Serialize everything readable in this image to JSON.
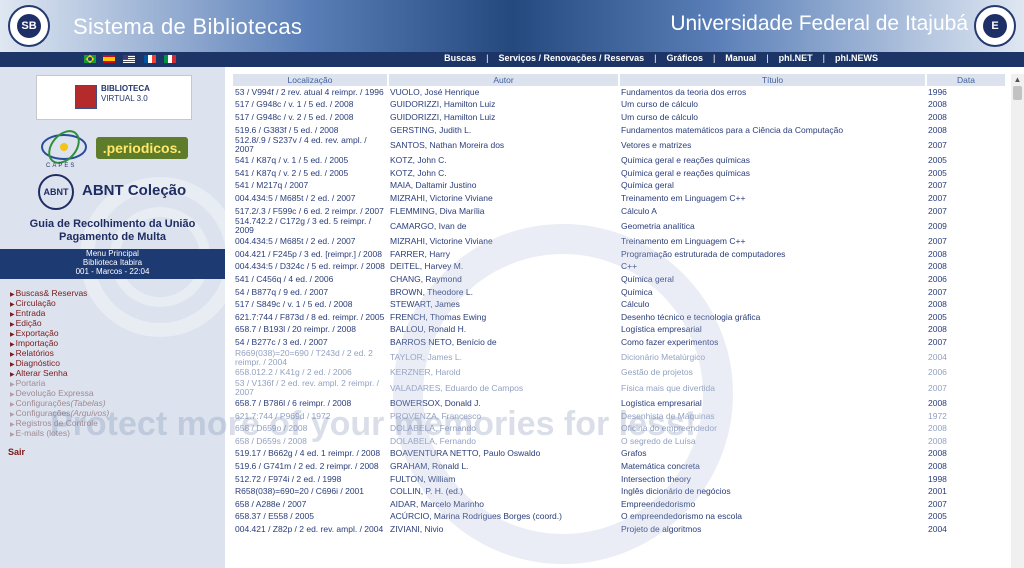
{
  "header": {
    "site_title": "Sistema de Bibliotecas",
    "university": "Universidade Federal de Itajubá",
    "left_logo_text": "SB",
    "right_logo_text": "E"
  },
  "nav": {
    "links": [
      "Buscas",
      "Serviços / Renovações / Reservas",
      "Gráficos",
      "Manual",
      "phl.NET",
      "phl.NEWS"
    ],
    "flags": [
      "flag-brazil",
      "flag-spain",
      "flag-usa",
      "flag-france",
      "flag-italy"
    ]
  },
  "sidebar": {
    "bv_line1": "BIBLIOTECA",
    "bv_line2": "VIRTUAL 3.0",
    "capes": "CAPES",
    "periodicos": ".periodicos.",
    "abnt_circle": "ABNT",
    "abnt_text": "ABNT Coleção",
    "guia_line1": "Guia de Recolhimento da União",
    "guia_line2": "Pagamento de Multa",
    "menu_box": [
      "Menu Principal",
      "Biblioteca Itabira",
      "001 - Marcos - 22:04"
    ],
    "menu": [
      {
        "label": "Buscas& Reservas",
        "extra": ""
      },
      {
        "label": "Circulação",
        "extra": ""
      },
      {
        "label": "Entrada",
        "extra": ""
      },
      {
        "label": "Edição",
        "extra": ""
      },
      {
        "label": "Exportação",
        "extra": ""
      },
      {
        "label": "Importação",
        "extra": ""
      },
      {
        "label": "Relatórios",
        "extra": ""
      },
      {
        "label": "Diagnóstico",
        "extra": ""
      },
      {
        "label": "Alterar Senha",
        "extra": ""
      },
      {
        "label": "Portaria",
        "extra": ""
      },
      {
        "label": "Devolução Expressa",
        "extra": ""
      },
      {
        "label": "Configurações",
        "extra": "(Tabelas)"
      },
      {
        "label": "Configurações",
        "extra": "(Arquivos)"
      },
      {
        "label": "Registros de Controle",
        "extra": ""
      },
      {
        "label": "E-mails (lotes)",
        "extra": ""
      }
    ],
    "sair": "Sair"
  },
  "table": {
    "headers": [
      "Localização",
      "Autor",
      "Título",
      "Data"
    ],
    "rows": [
      [
        "53 / V994f / 2 rev. atual 4 reimpr. / 1996",
        "VUOLO, José Henrique",
        "Fundamentos da teoria dos erros",
        "1996"
      ],
      [
        "517 / G948c / v. 1 / 5 ed. / 2008",
        "GUIDORIZZI, Hamilton Luiz",
        "Um curso de cálculo",
        "2008"
      ],
      [
        "517 / G948c / v. 2 / 5 ed. / 2008",
        "GUIDORIZZI, Hamilton Luiz",
        "Um curso de cálculo",
        "2008"
      ],
      [
        "519.6 / G383f / 5 ed. / 2008",
        "GERSTING, Judith L.",
        "Fundamentos matemáticos para a Ciência da Computação",
        "2008"
      ],
      [
        "512.8/.9 / S237v / 4 ed. rev. ampl. / 2007",
        "SANTOS, Nathan Moreira dos",
        "Vetores e matrizes",
        "2007"
      ],
      [
        "541 / K87q / v. 1 / 5 ed. / 2005",
        "KOTZ, John C.",
        "Química geral e reações químicas",
        "2005"
      ],
      [
        "541 / K87q / v. 2 / 5 ed. / 2005",
        "KOTZ, John C.",
        "Química geral e reações químicas",
        "2005"
      ],
      [
        "541 / M217q / 2007",
        "MAIA, Daltamir Justino",
        "Química geral",
        "2007"
      ],
      [
        "004.434:5 / M685t / 2 ed. / 2007",
        "MIZRAHI, Victorine Viviane",
        "Treinamento em Linguagem C++",
        "2007"
      ],
      [
        "517.2/.3 / F599c / 6 ed. 2 reimpr. / 2007",
        "FLEMMING, Diva Marília",
        "Cálculo A",
        "2007"
      ],
      [
        "514.742.2 / C172g / 3 ed. 5 reimpr. / 2009",
        "CAMARGO, Ivan de",
        "Geometria analítica",
        "2009"
      ],
      [
        "004.434:5 / M685t / 2 ed. / 2007",
        "MIZRAHI, Victorine Viviane",
        "Treinamento em Linguagem C++",
        "2007"
      ],
      [
        "004.421 / F245p / 3 ed. [reimpr.] / 2008",
        "FARRER, Harry",
        "Programação estruturada de computadores",
        "2008"
      ],
      [
        "004.434:5 / D324c / 5 ed. reimpr. / 2008",
        "DEITEL, Harvey M.",
        "C++",
        "2008"
      ],
      [
        "541 / C456q / 4 ed. / 2006",
        "CHANG, Raymond",
        "Química geral",
        "2006"
      ],
      [
        "54 / B877q / 9 ed. / 2007",
        "BROWN, Theodore L.",
        "Química",
        "2007"
      ],
      [
        "517 / S849c / v. 1 / 5 ed. / 2008",
        "STEWART, James",
        "Cálculo",
        "2008"
      ],
      [
        "621.7:744 / F873d / 8 ed. reimpr. / 2005",
        "FRENCH, Thomas Ewing",
        "Desenho técnico e tecnologia gráfica",
        "2005"
      ],
      [
        "658.7 / B193l / 20 reimpr. / 2008",
        "BALLOU, Ronald H.",
        "Logística empresarial",
        "2008"
      ],
      [
        "54 / B277c / 3 ed. / 2007",
        "BARROS NETO, Benício de",
        "Como fazer experimentos",
        "2007"
      ],
      [
        "R669(038)=20=690 / T243d / 2 ed. 2 reimpr. / 2004",
        "TAYLOR, James L.",
        "Dicionário Metalúrgico",
        "2004"
      ],
      [
        "658.012.2 / K41g / 2 ed. / 2006",
        "KERZNER, Harold",
        "Gestão de projetos",
        "2006"
      ],
      [
        "53 / V136f / 2 ed. rev. ampl. 2 reimpr. / 2007",
        "VALADARES, Eduardo de Campos",
        "Física mais que divertida",
        "2007"
      ],
      [
        "658.7 / B786l / 6 reimpr. / 2008",
        "BOWERSOX, Donald J.",
        "Logística empresarial",
        "2008"
      ],
      [
        "621.7:744 / P969d / 1972",
        "PROVENZA, Francesco",
        "Desenhista de Máquinas",
        "1972"
      ],
      [
        "658 / D659o / 2008",
        "DOLABELA, Fernando",
        "Oficina do empreendedor",
        "2008"
      ],
      [
        "658 / D659s / 2008",
        "DOLABELA, Fernando",
        "O segredo de Luísa",
        "2008"
      ],
      [
        "519.17 / B662g / 4 ed. 1 reimpr. / 2008",
        "BOAVENTURA NETTO, Paulo Oswaldo",
        "Grafos",
        "2008"
      ],
      [
        "519.6 / G741m / 2 ed. 2 reimpr. / 2008",
        "GRAHAM, Ronald L.",
        "Matemática concreta",
        "2008"
      ],
      [
        "512.72 / F974i / 2 ed. / 1998",
        "FULTON, William",
        "Intersection theory",
        "1998"
      ],
      [
        "R658(038)=690=20 / C696i / 2001",
        "COLLIN, P. H. (ed.)",
        "Inglês dicionário de negócios",
        "2001"
      ],
      [
        "658 / A288e / 2007",
        "AIDAR, Marcelo Marinho",
        "Empreendedorismo",
        "2007"
      ],
      [
        "658.37 / E558 / 2005",
        "ACÚRCIO, Marina Rodrigues Borges (coord.)",
        "O empreendedorismo na escola",
        "2005"
      ],
      [
        "004.421 / Z82p / 2 ed. rev. ampl. / 2004",
        "ZIVIANI, Nivio",
        "Projeto de algoritmos",
        "2004"
      ]
    ],
    "faint_rows": [
      20,
      21,
      22,
      24,
      25,
      26
    ],
    "tall_rows": [
      4,
      10,
      20,
      22
    ]
  },
  "watermark": "Protect more of your memories for less!",
  "colors": {
    "header_mid": "#23497f",
    "navbar": "#1c3566",
    "sidebar": "#dce3ef",
    "text_blue": "#2a3d7a",
    "menu_red": "#7a1a1a"
  }
}
